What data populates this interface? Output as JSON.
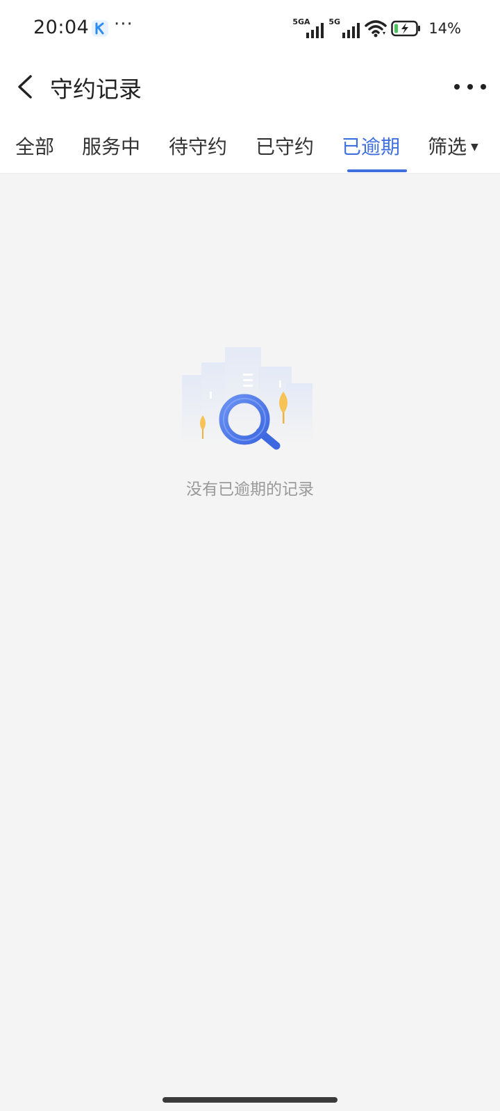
{
  "status_bar": {
    "time": "20:04",
    "app_icon": "k-app-icon",
    "more": "···",
    "signal1_label": "5GA",
    "signal2_label": "5G",
    "battery": "14%"
  },
  "header": {
    "title": "守约记录",
    "back_icon": "chevron-left-icon",
    "more_icon": "more-horizontal-icon"
  },
  "tabs": [
    {
      "label": "全部"
    },
    {
      "label": "服务中"
    },
    {
      "label": "待守约"
    },
    {
      "label": "已守约"
    },
    {
      "label": "已逾期",
      "active": true
    },
    {
      "label": "筛选"
    }
  ],
  "empty_state": {
    "icon": "search-magnifier-illustration",
    "text": "没有已逾期的记录"
  },
  "colors": {
    "accent": "#3f6fde",
    "background": "#f4f4f4",
    "muted_text": "#999999"
  }
}
